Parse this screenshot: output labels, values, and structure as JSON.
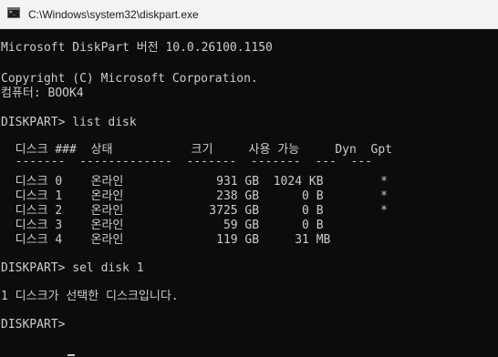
{
  "window": {
    "title": "C:\\Windows\\system32\\diskpart.exe",
    "icon": "console-icon"
  },
  "console": {
    "lines": [
      "Microsoft DiskPart 버전 10.0.26100.1150",
      "Copyright (C) Microsoft Corporation.",
      "컴퓨터: BOOK4",
      "DISKPART> list disk",
      "  디스크 ###  상태           크기     사용 가능     Dyn  Gpt",
      "  -------  -------------  -------  -------  ---  ---",
      "  디스크 0    온라인             931 GB  1024 KB        *",
      "  디스크 1    온라인             238 GB      0 B        *",
      "  디스크 2    온라인            3725 GB      0 B        *",
      "  디스크 3    온라인              59 GB      0 B",
      "  디스크 4    온라인             119 GB     31 MB",
      "DISKPART> sel disk 1",
      "1 디스크가 선택한 디스크입니다.",
      "DISKPART> "
    ]
  }
}
